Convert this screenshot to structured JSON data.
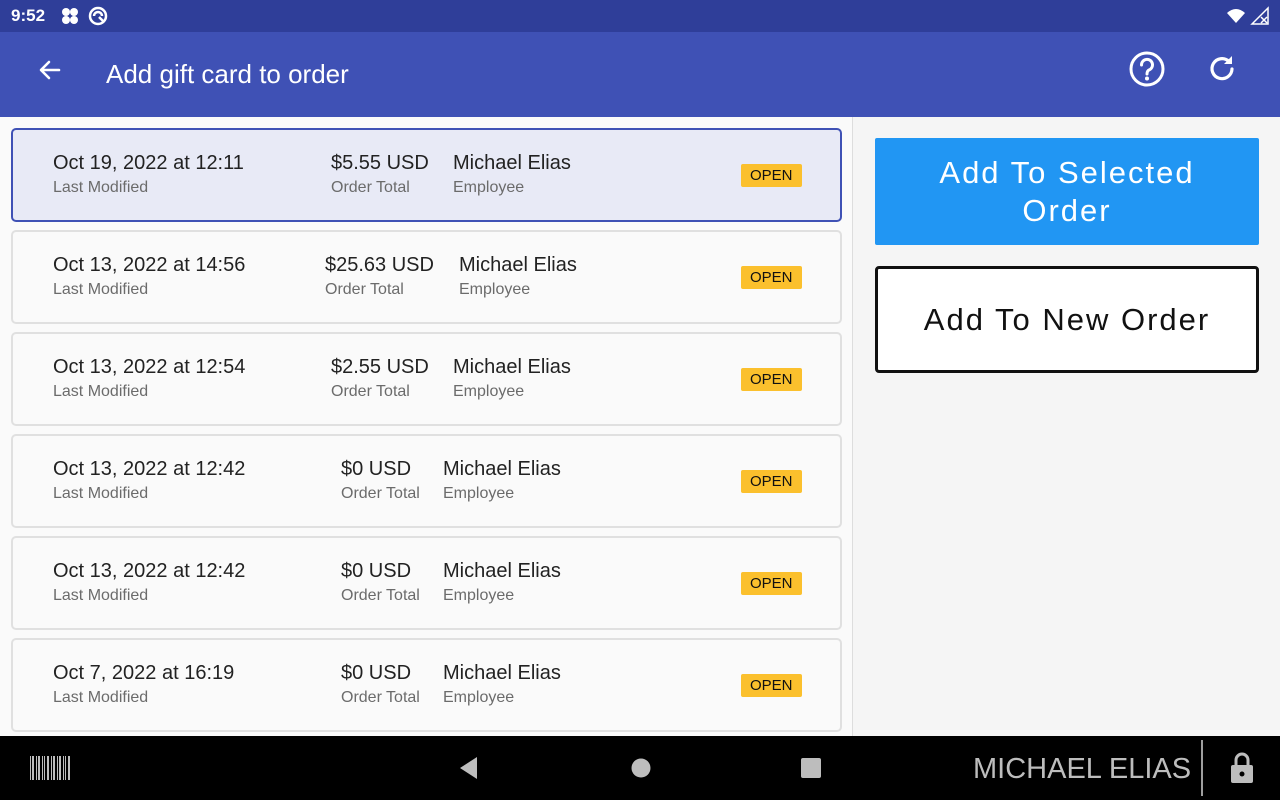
{
  "status_bar": {
    "time": "9:52"
  },
  "header": {
    "title": "Add gift card to order",
    "back_icon": "arrow-left-icon",
    "help_icon": "help-circle-icon",
    "refresh_icon": "refresh-icon"
  },
  "orders": [
    {
      "date": "Oct 19, 2022 at 12:11",
      "date_label": "Last Modified",
      "total": "$5.55 USD",
      "total_label": "Order Total",
      "employee": "Michael Elias",
      "employee_label": "Employee",
      "status": "OPEN",
      "selected": true
    },
    {
      "date": "Oct 13, 2022 at 14:56",
      "date_label": "Last Modified",
      "total": "$25.63 USD",
      "total_label": "Order Total",
      "employee": "Michael Elias",
      "employee_label": "Employee",
      "status": "OPEN",
      "selected": false
    },
    {
      "date": "Oct 13, 2022 at 12:54",
      "date_label": "Last Modified",
      "total": "$2.55 USD",
      "total_label": "Order Total",
      "employee": "Michael Elias",
      "employee_label": "Employee",
      "status": "OPEN",
      "selected": false
    },
    {
      "date": "Oct 13, 2022 at 12:42",
      "date_label": "Last Modified",
      "total": "$0 USD",
      "total_label": "Order Total",
      "employee": "Michael Elias",
      "employee_label": "Employee",
      "status": "OPEN",
      "selected": false
    },
    {
      "date": "Oct 13, 2022 at 12:42",
      "date_label": "Last Modified",
      "total": "$0 USD",
      "total_label": "Order Total",
      "employee": "Michael Elias",
      "employee_label": "Employee",
      "status": "OPEN",
      "selected": false
    },
    {
      "date": "Oct 7, 2022 at 16:19",
      "date_label": "Last Modified",
      "total": "$0 USD",
      "total_label": "Order Total",
      "employee": "Michael Elias",
      "employee_label": "Employee",
      "status": "OPEN",
      "selected": false
    }
  ],
  "actions": {
    "add_selected_line1": "Add To Selected",
    "add_selected_line2": "Order",
    "add_new": "Add To New Order"
  },
  "nav_bar": {
    "user_name": "MICHAEL ELIAS"
  },
  "colors": {
    "app_bar": "#3f51b5",
    "status_bar": "#2f3e99",
    "primary_button": "#2196f3",
    "status_pill": "#fbc02d",
    "selected_card": "#e8eaf6"
  }
}
